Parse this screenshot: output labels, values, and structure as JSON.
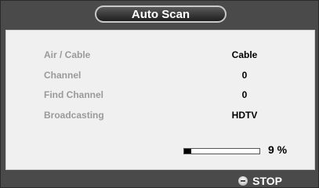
{
  "window": {
    "title": "Auto Scan"
  },
  "settings": [
    {
      "label": "Air / Cable",
      "value": "Cable"
    },
    {
      "label": "Channel",
      "value": "0"
    },
    {
      "label": "Find Channel",
      "value": "0"
    },
    {
      "label": "Broadcasting",
      "value": "HDTV"
    }
  ],
  "progress": {
    "percent": 9,
    "text": "9 %"
  },
  "footer": {
    "stop_label": "STOP",
    "stop_icon": "stop-button-icon"
  },
  "colors": {
    "frame": "#4a4a4a",
    "panel": "#f0f0f0",
    "label": "#9a9a9a",
    "value": "#000000"
  }
}
